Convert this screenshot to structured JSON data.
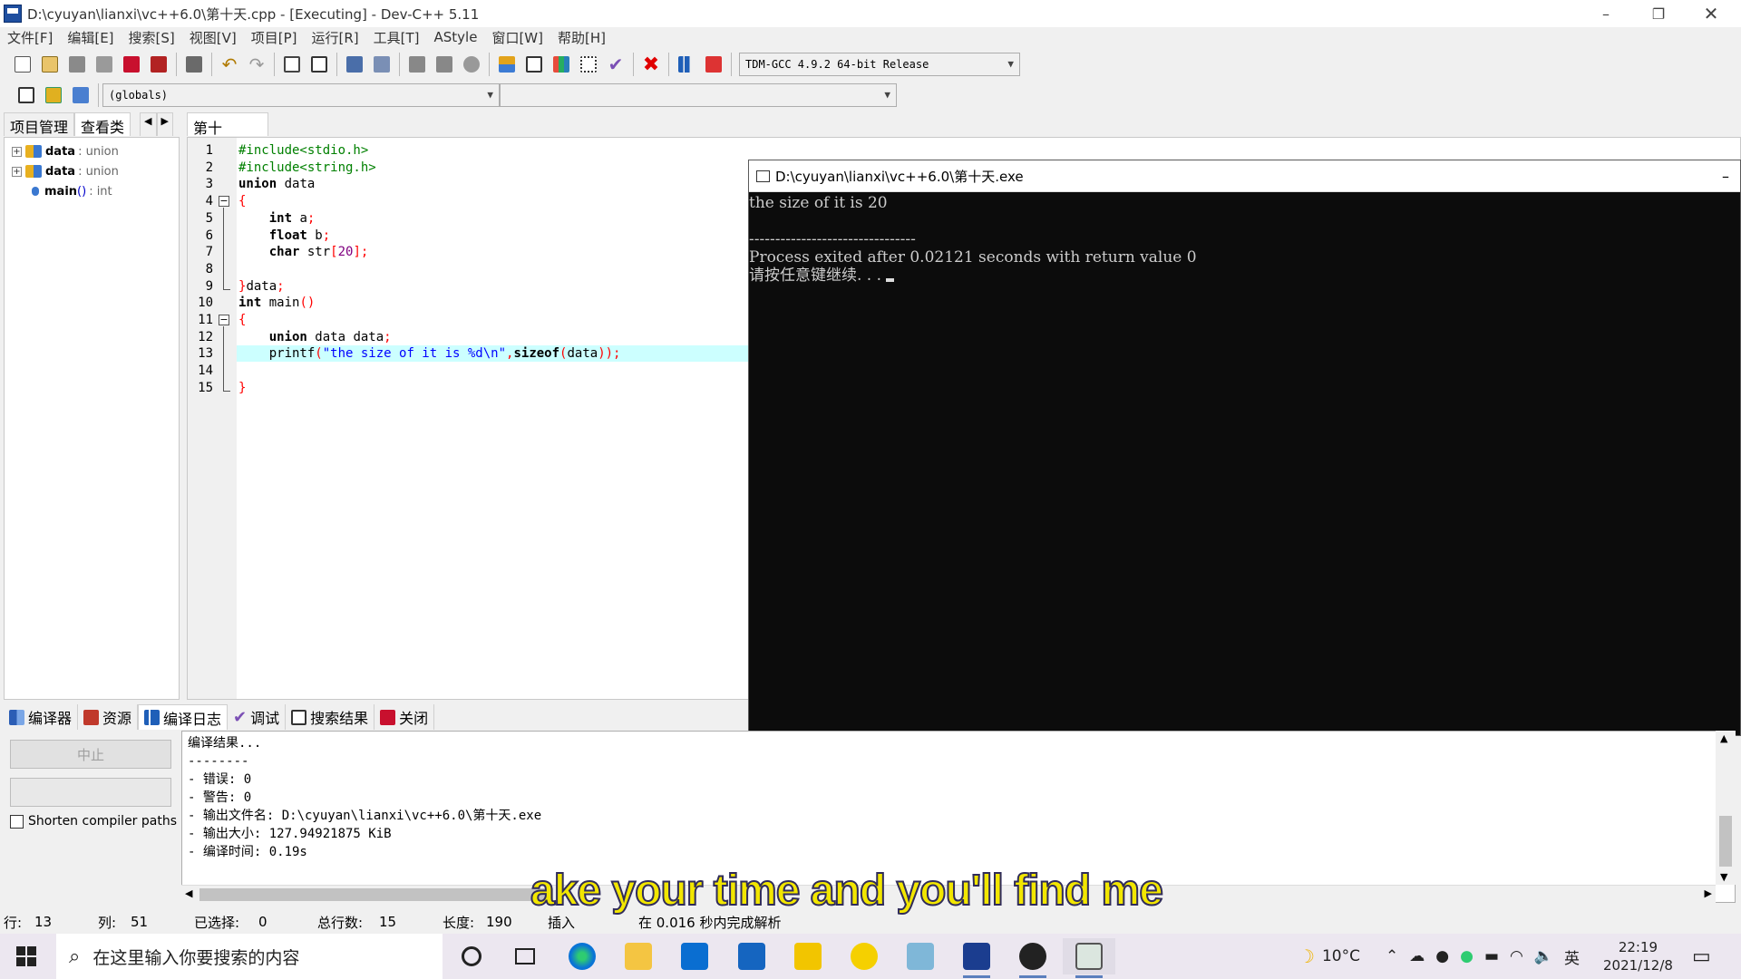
{
  "window": {
    "title": "D:\\cyuyan\\lianxi\\vc++6.0\\第十天.cpp - [Executing] - Dev-C++ 5.11"
  },
  "menu": [
    "文件[F]",
    "编辑[E]",
    "搜索[S]",
    "视图[V]",
    "项目[P]",
    "运行[R]",
    "工具[T]",
    "AStyle",
    "窗口[W]",
    "帮助[H]"
  ],
  "toolbar": {
    "compiler_select": "TDM-GCC 4.9.2 64-bit Release",
    "scope_select": "(globals)",
    "function_select": ""
  },
  "left_tabs": [
    "项目管理",
    "查看类"
  ],
  "class_tree": [
    {
      "name": "data",
      "type": ": union"
    },
    {
      "name": "data",
      "type": ": union"
    },
    {
      "name": "main",
      "args": "()",
      "type": ": int"
    }
  ],
  "editor": {
    "tab": "第十天.cpp",
    "lines": [
      {
        "n": "1",
        "html": "<span class='pp'>#include&lt;stdio.h&gt;</span>"
      },
      {
        "n": "2",
        "html": "<span class='pp'>#include&lt;string.h&gt;</span>"
      },
      {
        "n": "3",
        "html": "<span class='kw'>union</span> data"
      },
      {
        "n": "4",
        "html": "<span class='sym'>{</span>"
      },
      {
        "n": "5",
        "html": "    <span class='kw'>int</span> a<span class='sym'>;</span>"
      },
      {
        "n": "6",
        "html": "    <span class='kw'>float</span> b<span class='sym'>;</span>"
      },
      {
        "n": "7",
        "html": "    <span class='kw'>char</span> str<span class='sym'>[</span><span class='num'>20</span><span class='sym'>];</span>"
      },
      {
        "n": "8",
        "html": ""
      },
      {
        "n": "9",
        "html": "<span class='sym'>}</span>data<span class='sym'>;</span>"
      },
      {
        "n": "10",
        "html": "<span class='kw'>int</span> main<span class='sym'>()</span>"
      },
      {
        "n": "11",
        "html": "<span class='sym'>{</span>"
      },
      {
        "n": "12",
        "html": "    <span class='kw'>union</span> data data<span class='sym'>;</span>"
      },
      {
        "n": "13",
        "html": "    printf<span class='sym'>(</span><span class='str'>\"the size of it is %d\\n\"</span><span class='sym'>,</span><span class='kw'>sizeof</span><span class='sym'>(</span>data<span class='sym'>));</span>"
      },
      {
        "n": "14",
        "html": ""
      },
      {
        "n": "15",
        "html": "<span class='sym'>}</span>"
      }
    ]
  },
  "console": {
    "title": "D:\\cyuyan\\lianxi\\vc++6.0\\第十天.exe",
    "lines": [
      "the size of it is 20",
      "",
      "--------------------------------",
      "Process exited after 0.02121 seconds with return value 0",
      "请按任意键继续. . . "
    ]
  },
  "bottom_tabs": [
    "编译器",
    "资源",
    "编译日志",
    "调试",
    "搜索结果",
    "关闭"
  ],
  "bottom_panel": {
    "abort_button": "中止",
    "shorten_label": "Shorten compiler paths",
    "log": [
      "编译结果...",
      "--------",
      "- 错误: 0",
      "- 警告: 0",
      "- 输出文件名: D:\\cyuyan\\lianxi\\vc++6.0\\第十天.exe",
      "- 输出大小: 127.94921875 KiB",
      "- 编译时间: 0.19s"
    ]
  },
  "status": {
    "row_label": "行:",
    "row": "13",
    "col_label": "列:",
    "col": "51",
    "sel_label": "已选择:",
    "sel": "0",
    "lines_label": "总行数:",
    "lines": "15",
    "len_label": "长度:",
    "len": "190",
    "mode": "插入",
    "parse": "在 0.016 秒内完成解析"
  },
  "subtitle": "ake your time and you'll find me",
  "taskbar": {
    "search_placeholder": "在这里输入你要搜索的内容",
    "temp": "10°C",
    "ime": "英",
    "time": "22:19",
    "date": "2021/12/8"
  },
  "colors": {
    "accent_blue": "#0078d7",
    "line_highlight": "#ccffff",
    "console_bg": "#0c0c0c"
  }
}
